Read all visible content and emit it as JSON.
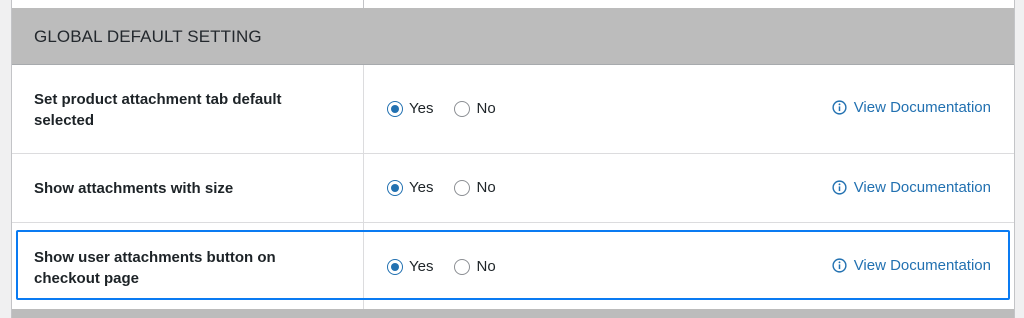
{
  "section": {
    "title": "GLOBAL DEFAULT SETTING"
  },
  "colors": {
    "accent": "#2271b1",
    "header_bg": "#bcbcbc",
    "highlight_border": "#0a7bf2"
  },
  "rows": [
    {
      "label": "Set product attachment tab default selected",
      "options": [
        {
          "label": "Yes",
          "checked": true
        },
        {
          "label": "No",
          "checked": false
        }
      ],
      "link": {
        "icon": "info-icon",
        "text": "View Documentation"
      }
    },
    {
      "label": "Show attachments with size",
      "options": [
        {
          "label": "Yes",
          "checked": true
        },
        {
          "label": "No",
          "checked": false
        }
      ],
      "link": {
        "icon": "info-icon",
        "text": "View Documentation"
      }
    },
    {
      "label": "Show user attachments button on checkout page",
      "options": [
        {
          "label": "Yes",
          "checked": true
        },
        {
          "label": "No",
          "checked": false
        }
      ],
      "link": {
        "icon": "info-icon",
        "text": "View Documentation"
      },
      "highlighted": true
    }
  ]
}
